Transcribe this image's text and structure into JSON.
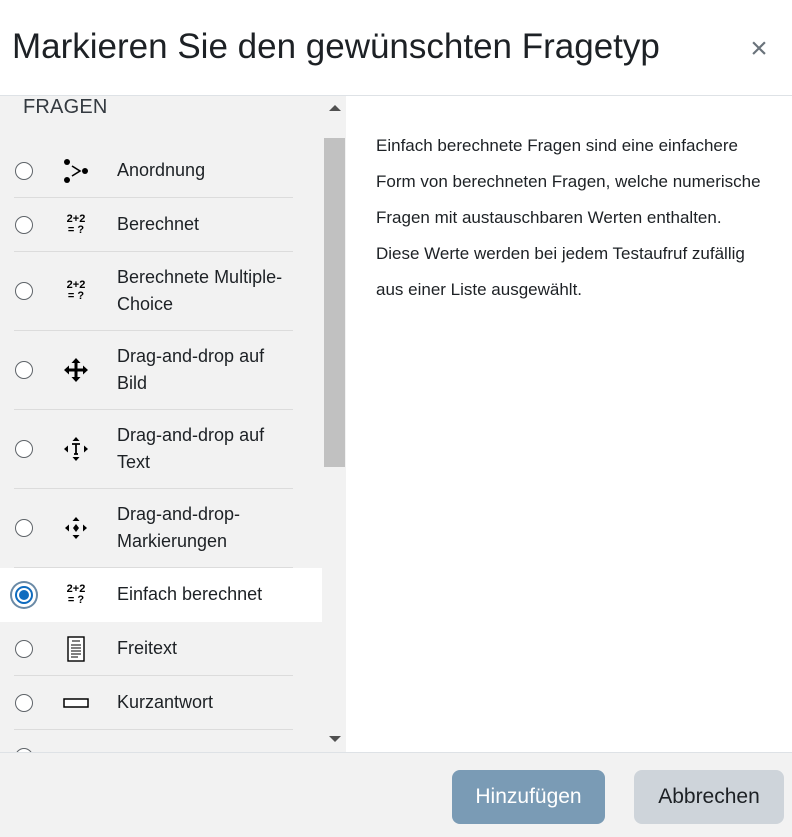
{
  "dialog": {
    "title": "Markieren Sie den gewünschten Fragetyp",
    "close_icon": "×"
  },
  "list": {
    "section_label": "FRAGEN",
    "items": [
      {
        "label": "Anordnung",
        "icon": "ordering-icon",
        "selected": false
      },
      {
        "label": "Berechnet",
        "icon": "calculated-icon",
        "selected": false
      },
      {
        "label": "Berechnete Multiple-Choice",
        "icon": "calculated-multichoice-icon",
        "selected": false
      },
      {
        "label": "Drag-and-drop auf Bild",
        "icon": "move-arrows-icon",
        "selected": false
      },
      {
        "label": "Drag-and-drop auf Text",
        "icon": "drag-text-icon",
        "selected": false
      },
      {
        "label": "Drag-and-drop-Markierungen",
        "icon": "drag-markers-icon",
        "selected": false
      },
      {
        "label": "Einfach berechnet",
        "icon": "calculated-simple-icon",
        "selected": true
      },
      {
        "label": "Freitext",
        "icon": "essay-icon",
        "selected": false
      },
      {
        "label": "Kurzantwort",
        "icon": "shortanswer-icon",
        "selected": false
      }
    ]
  },
  "calc_icon_text": {
    "top": "2+2",
    "bottom": "= ?"
  },
  "description": "Einfach berechnete Fragen sind eine einfachere Form von berechneten Fragen, welche numerische Fragen mit austauschbaren Werten enthalten. Diese Werte werden bei jedem Testaufruf zufällig aus einer Liste ausgewählt.",
  "footer": {
    "add_label": "Hinzufügen",
    "cancel_label": "Abbrechen"
  },
  "colors": {
    "primary_button": "#7a9bb5",
    "secondary_button": "#ced4da",
    "selected_radio": "#0f6cbf",
    "left_panel": "#f2f2f2"
  }
}
